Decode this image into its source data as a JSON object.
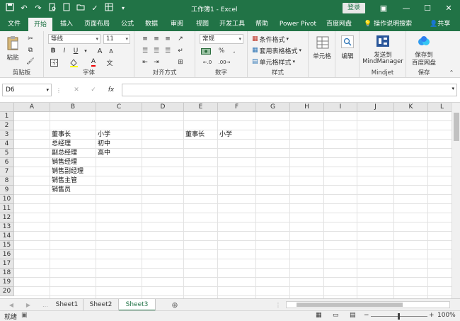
{
  "window": {
    "title": "工作簿1 - Excel",
    "login_label": "登录",
    "controls": [
      "restore-ribbon",
      "minimize",
      "maximize",
      "close"
    ]
  },
  "quick_access": [
    "save-icon",
    "undo-icon",
    "redo-icon",
    "print-preview-icon",
    "new-icon",
    "open-icon",
    "check-icon",
    "grid-icon"
  ],
  "tabs": [
    {
      "label": "文件"
    },
    {
      "label": "开始"
    },
    {
      "label": "插入"
    },
    {
      "label": "页面布局"
    },
    {
      "label": "公式"
    },
    {
      "label": "数据"
    },
    {
      "label": "审阅"
    },
    {
      "label": "视图"
    },
    {
      "label": "开发工具"
    },
    {
      "label": "帮助"
    },
    {
      "label": "Power Pivot"
    },
    {
      "label": "百度网盘"
    }
  ],
  "active_tab": "开始",
  "tell_me": "操作说明搜索",
  "share": "共享",
  "ribbon": {
    "clipboard": {
      "label": "剪贴板",
      "paste": "粘贴"
    },
    "font": {
      "label": "字体",
      "font_name": "等线",
      "font_size": "11",
      "bold": "B",
      "italic": "I",
      "underline": "U",
      "font_color": "A"
    },
    "alignment": {
      "label": "对齐方式"
    },
    "number": {
      "label": "数字",
      "format": "常规",
      "percent": "%"
    },
    "styles": {
      "label": "样式",
      "conditional": "条件格式",
      "table": "套用表格格式",
      "cell_styles": "单元格样式"
    },
    "cells": {
      "label": "单元格"
    },
    "editing": {
      "label": "编辑"
    },
    "mindjet": {
      "label": "Mindjet",
      "send": "发送到",
      "app": "MindManager"
    },
    "save": {
      "label": "保存",
      "save_to": "保存到",
      "target": "百度网盘"
    }
  },
  "formula_bar": {
    "name_box": "D6",
    "fx": "fx",
    "value": ""
  },
  "columns": [
    "A",
    "B",
    "C",
    "D",
    "E",
    "F",
    "G",
    "H",
    "I",
    "J",
    "K",
    "L"
  ],
  "rows": [
    "1",
    "2",
    "3",
    "4",
    "5",
    "6",
    "7",
    "8",
    "9",
    "10",
    "11",
    "12",
    "13",
    "14",
    "15",
    "16",
    "17",
    "18",
    "19",
    "20"
  ],
  "cells": {
    "B3": "董事长",
    "B4": "总经理",
    "B5": "副总经理",
    "B6": "销售经理",
    "B7": "销售副经理",
    "B8": "销售主管",
    "B9": "销售员",
    "C3": "小学",
    "C4": "初中",
    "C5": "高中",
    "E3": "董事长",
    "F3": "小学"
  },
  "sheets": [
    {
      "label": "Sheet1"
    },
    {
      "label": "Sheet2"
    },
    {
      "label": "Sheet3"
    }
  ],
  "active_sheet": "Sheet3",
  "status": {
    "ready": "就绪",
    "zoom": "100%"
  },
  "colors": {
    "accent": "#217346"
  }
}
